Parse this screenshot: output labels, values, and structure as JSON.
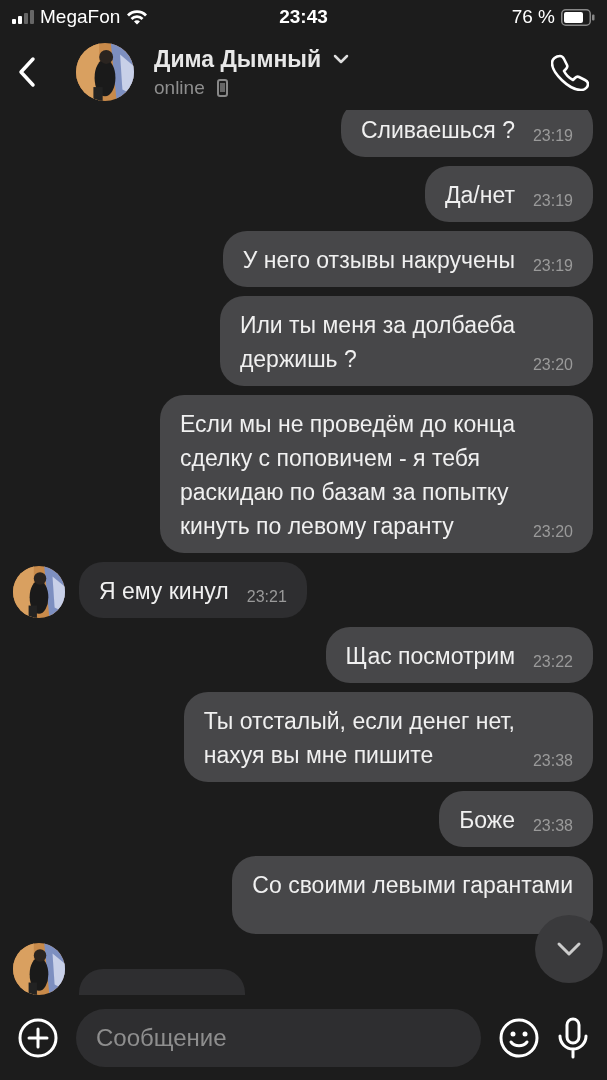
{
  "status_bar": {
    "carrier": "MegaFon",
    "time": "23:43",
    "battery": "76 %"
  },
  "header": {
    "name": "Дима Дымный",
    "presence": "online"
  },
  "messages": [
    {
      "kind": "text",
      "outgoing": true,
      "text": "Сливаешься ?",
      "time": "23:19"
    },
    {
      "kind": "text",
      "outgoing": true,
      "text": "Да/нет",
      "time": "23:19"
    },
    {
      "kind": "text",
      "outgoing": true,
      "text": "У него отзывы накручены",
      "time": "23:19"
    },
    {
      "kind": "text",
      "outgoing": true,
      "text": "Или ты меня за долбаеба\nдержишь ?",
      "time": "23:20"
    },
    {
      "kind": "text",
      "outgoing": true,
      "text": "Если мы не проведём до конца\nсделку с поповичем - я тебя\nраскидаю по базам за попытку\nкинуть по левому гаранту",
      "time": "23:20"
    },
    {
      "kind": "text",
      "outgoing": false,
      "text": "Я ему кинул",
      "time": "23:21"
    },
    {
      "kind": "text",
      "outgoing": true,
      "text": "Щас посмотрим",
      "time": "23:22"
    },
    {
      "kind": "text",
      "outgoing": true,
      "text": "Ты отсталый, если денег нет,\nнахуя вы мне пишите",
      "time": "23:38"
    },
    {
      "kind": "text",
      "outgoing": true,
      "text": "Боже",
      "time": "23:38"
    },
    {
      "kind": "text",
      "outgoing": true,
      "text": "Со своими левыми гарантами"
    },
    {
      "kind": "partial",
      "outgoing": false
    }
  ],
  "composer": {
    "placeholder": "Сообщение"
  }
}
